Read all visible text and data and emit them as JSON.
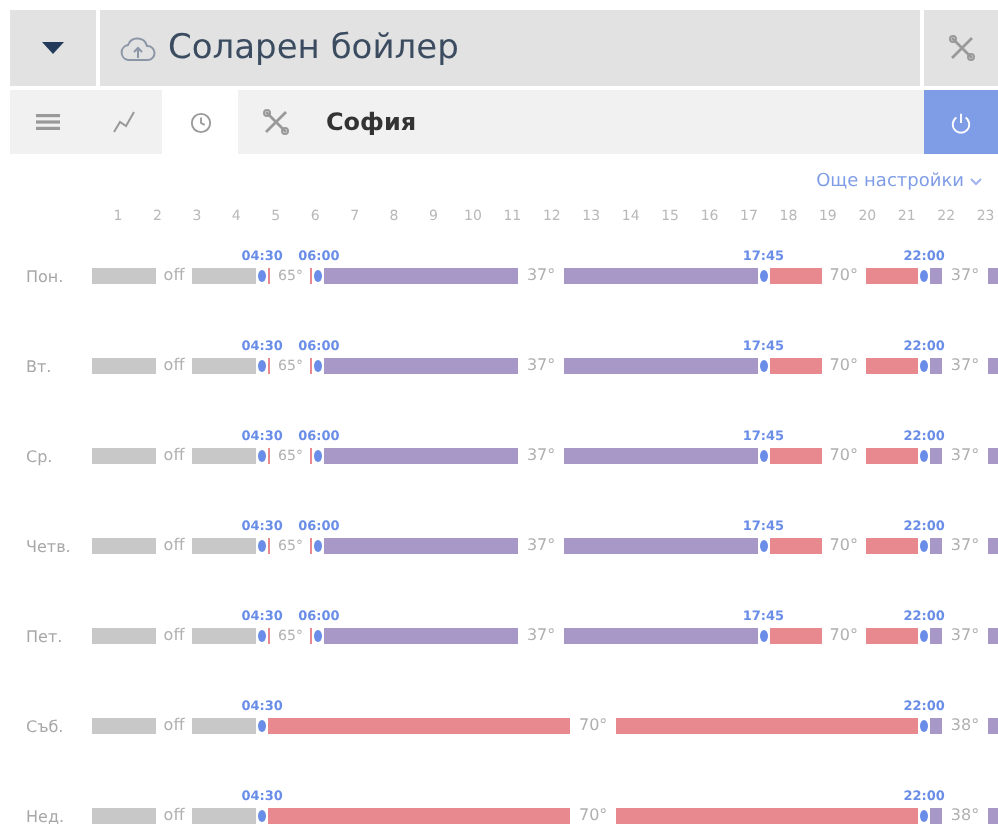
{
  "header": {
    "title": "Соларен бойлер"
  },
  "tabs": [
    {
      "kind": "menu",
      "selected": false
    },
    {
      "kind": "chart",
      "selected": false
    },
    {
      "kind": "clock",
      "selected": true
    },
    {
      "kind": "tools",
      "selected": false
    }
  ],
  "location": "София",
  "more_settings": "Още настройки",
  "hours": [
    "1",
    "2",
    "3",
    "4",
    "5",
    "6",
    "7",
    "8",
    "9",
    "10",
    "11",
    "12",
    "13",
    "14",
    "15",
    "16",
    "17",
    "18",
    "19",
    "20",
    "21",
    "22",
    "23"
  ],
  "days": [
    {
      "day": "Пон.",
      "switches": [
        "04:30",
        "06:00",
        "17:45",
        "22:00"
      ],
      "segments": [
        {
          "label": "off",
          "color": "#c8c8c8",
          "kind": "fill"
        },
        {
          "label": "65°",
          "color": "#e8888f",
          "kind": "outline"
        },
        {
          "label": "37°",
          "color": "#a898c8",
          "kind": "fill"
        },
        {
          "label": "70°",
          "color": "#e8888f",
          "kind": "fill"
        },
        {
          "label": "37°",
          "color": "#a898c8",
          "kind": "fill"
        }
      ]
    },
    {
      "day": "Вт.",
      "switches": [
        "04:30",
        "06:00",
        "17:45",
        "22:00"
      ],
      "segments": [
        {
          "label": "off",
          "color": "#c8c8c8",
          "kind": "fill"
        },
        {
          "label": "65°",
          "color": "#e8888f",
          "kind": "outline"
        },
        {
          "label": "37°",
          "color": "#a898c8",
          "kind": "fill"
        },
        {
          "label": "70°",
          "color": "#e8888f",
          "kind": "fill"
        },
        {
          "label": "37°",
          "color": "#a898c8",
          "kind": "fill"
        }
      ]
    },
    {
      "day": "Ср.",
      "switches": [
        "04:30",
        "06:00",
        "17:45",
        "22:00"
      ],
      "segments": [
        {
          "label": "off",
          "color": "#c8c8c8",
          "kind": "fill"
        },
        {
          "label": "65°",
          "color": "#e8888f",
          "kind": "outline"
        },
        {
          "label": "37°",
          "color": "#a898c8",
          "kind": "fill"
        },
        {
          "label": "70°",
          "color": "#e8888f",
          "kind": "fill"
        },
        {
          "label": "37°",
          "color": "#a898c8",
          "kind": "fill"
        }
      ]
    },
    {
      "day": "Четв.",
      "switches": [
        "04:30",
        "06:00",
        "17:45",
        "22:00"
      ],
      "segments": [
        {
          "label": "off",
          "color": "#c8c8c8",
          "kind": "fill"
        },
        {
          "label": "65°",
          "color": "#e8888f",
          "kind": "outline"
        },
        {
          "label": "37°",
          "color": "#a898c8",
          "kind": "fill"
        },
        {
          "label": "70°",
          "color": "#e8888f",
          "kind": "fill"
        },
        {
          "label": "37°",
          "color": "#a898c8",
          "kind": "fill"
        }
      ]
    },
    {
      "day": "Пет.",
      "switches": [
        "04:30",
        "06:00",
        "17:45",
        "22:00"
      ],
      "segments": [
        {
          "label": "off",
          "color": "#c8c8c8",
          "kind": "fill"
        },
        {
          "label": "65°",
          "color": "#e8888f",
          "kind": "outline"
        },
        {
          "label": "37°",
          "color": "#a898c8",
          "kind": "fill"
        },
        {
          "label": "70°",
          "color": "#e8888f",
          "kind": "fill"
        },
        {
          "label": "37°",
          "color": "#a898c8",
          "kind": "fill"
        }
      ]
    },
    {
      "day": "Съб.",
      "switches": [
        "04:30",
        "22:00"
      ],
      "segments": [
        {
          "label": "off",
          "color": "#c8c8c8",
          "kind": "fill"
        },
        {
          "label": "70°",
          "color": "#e8888f",
          "kind": "fill"
        },
        {
          "label": "38°",
          "color": "#a898c8",
          "kind": "fill"
        }
      ]
    },
    {
      "day": "Нед.",
      "switches": [
        "04:30",
        "22:00"
      ],
      "segments": [
        {
          "label": "off",
          "color": "#c8c8c8",
          "kind": "fill"
        },
        {
          "label": "70°",
          "color": "#e8888f",
          "kind": "fill"
        },
        {
          "label": "38°",
          "color": "#a898c8",
          "kind": "fill"
        }
      ]
    }
  ]
}
